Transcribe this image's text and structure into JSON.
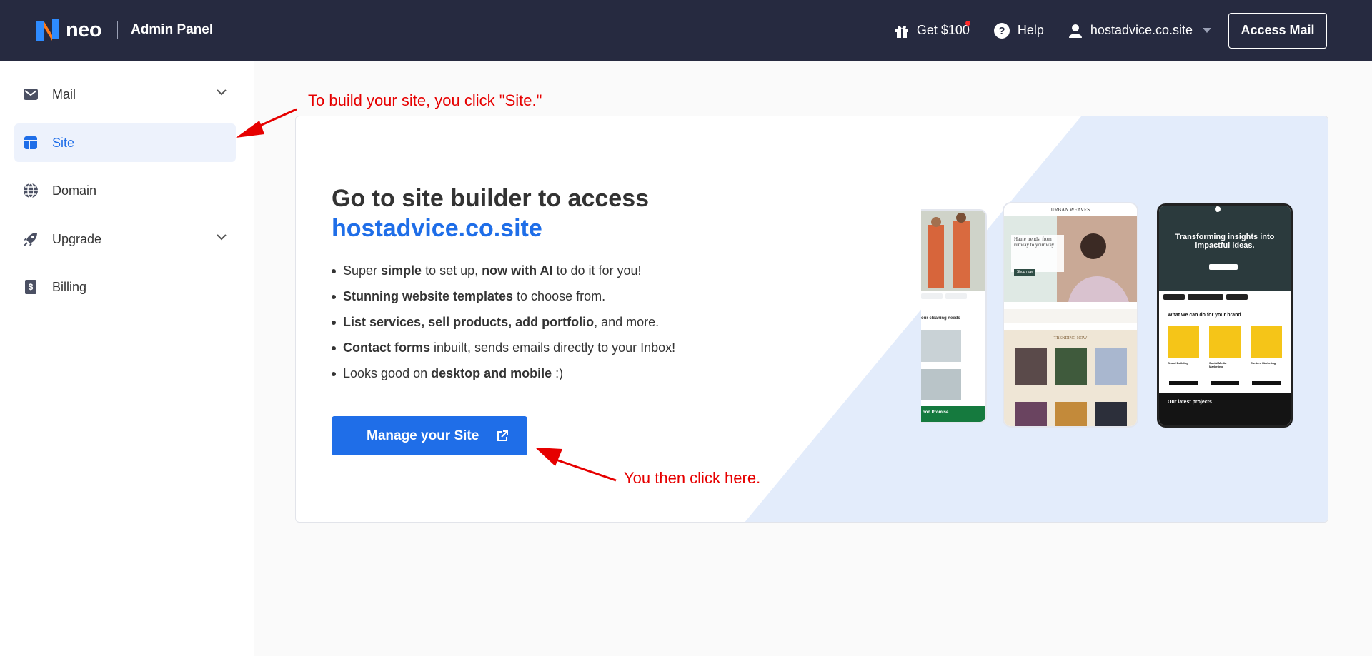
{
  "header": {
    "brand_name": "neo",
    "brand_sub": "Admin Panel",
    "get_label": "Get $100",
    "help_label": "Help",
    "account_label": "hostadvice.co.site",
    "access_mail_label": "Access Mail"
  },
  "sidebar": {
    "items": [
      {
        "label": "Mail",
        "icon": "mail-icon",
        "has_chevron": true
      },
      {
        "label": "Site",
        "icon": "site-icon",
        "active": true
      },
      {
        "label": "Domain",
        "icon": "globe-icon"
      },
      {
        "label": "Upgrade",
        "icon": "rocket-icon",
        "has_chevron": true
      },
      {
        "label": "Billing",
        "icon": "billing-icon"
      }
    ]
  },
  "main": {
    "headline_line1": "Go to site builder to access",
    "headline_domain": "hostadvice.co.site",
    "features": [
      [
        {
          "t": "Super "
        },
        {
          "b": "simple"
        },
        {
          "t": " to set up, "
        },
        {
          "b": "now with AI"
        },
        {
          "t": " to do it for you!"
        }
      ],
      [
        {
          "b": "Stunning website templates"
        },
        {
          "t": " to choose from."
        }
      ],
      [
        {
          "b": "List services, sell products, add portfolio"
        },
        {
          "t": ", and more."
        }
      ],
      [
        {
          "b": "Contact forms"
        },
        {
          "t": " inbuilt, sends emails directly to your Inbox!"
        }
      ],
      [
        {
          "t": "Looks good on "
        },
        {
          "b": "desktop and mobile"
        },
        {
          "t": " :)"
        }
      ]
    ],
    "manage_button_label": "Manage your Site"
  },
  "mockups": {
    "phone_a": {
      "caption": "our cleaning needs",
      "footer": "ood Promise"
    },
    "phone_b": {
      "brand": "URBAN WEAVES",
      "hero_text": "Haute trends, from runway to your way!",
      "cta": "Shop now",
      "section": "— TRENDING NOW —"
    },
    "phone_c": {
      "hero_text": "Transforming insights into impactful ideas.",
      "section": "What we can do for your brand",
      "cards": [
        "Brand Building",
        "Social Media Marketing",
        "Content Marketing"
      ],
      "footer": "Our latest projects"
    }
  },
  "annotations": {
    "note1": "To build your site, you click \"Site.\"",
    "note2": "You then click here."
  },
  "colors": {
    "header_bg": "#262a40",
    "accent": "#1f6ee8",
    "annotation": "#e60000",
    "active_bg": "#edf2fc"
  }
}
